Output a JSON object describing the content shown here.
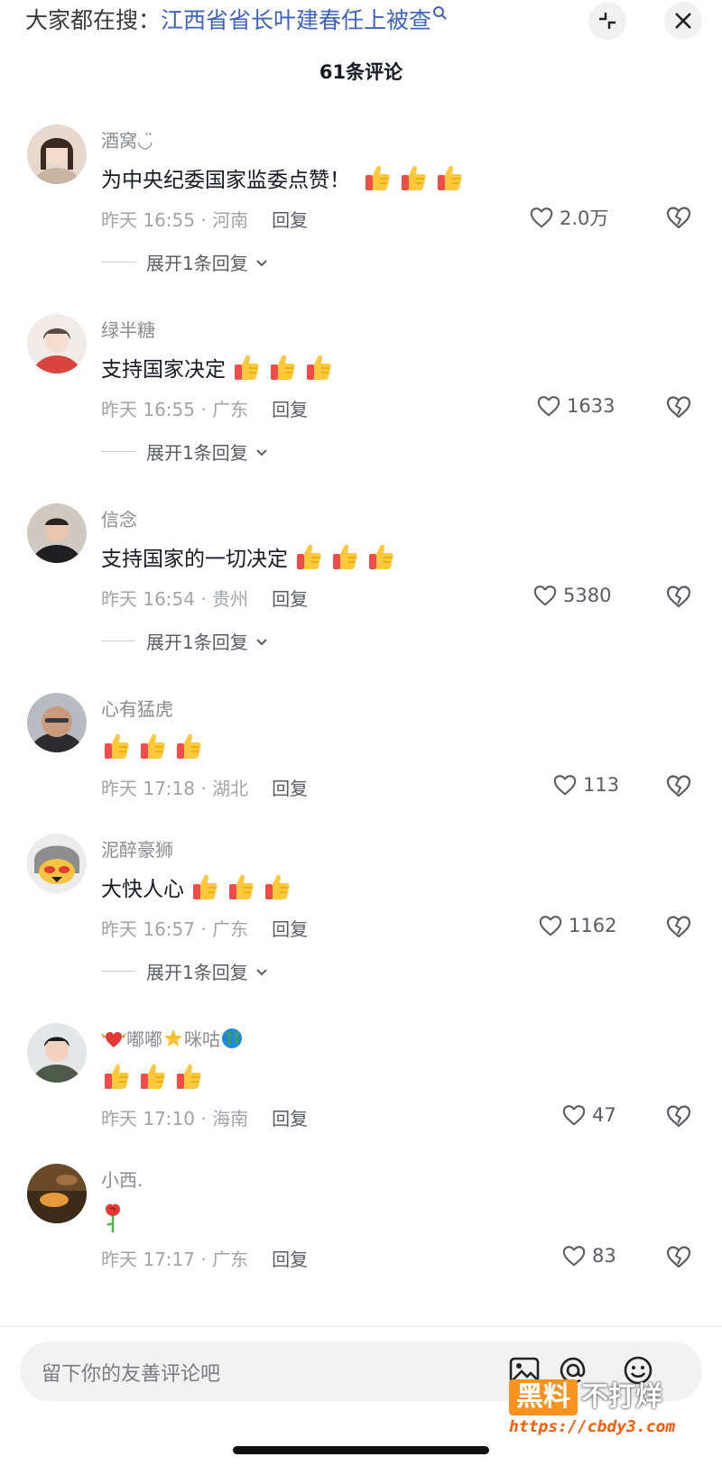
{
  "header": {
    "search_prefix": "大家都在搜：",
    "search_topic": "江西省省长叶建春任上被查",
    "comment_count": "61条评论"
  },
  "comments": [
    {
      "user": "酒窝◡̈",
      "text": "为中央纪委国家监委点赞！",
      "thumbs": 3,
      "time_location": "昨天 16:55 · 河南",
      "reply": "回复",
      "likes": "2.0万",
      "expand": "展开1条回复"
    },
    {
      "user": "绿半糖",
      "text": "支持国家决定",
      "thumbs": 3,
      "time_location": "昨天 16:55 · 广东",
      "reply": "回复",
      "likes": "1633",
      "expand": "展开1条回复"
    },
    {
      "user": "信念",
      "text": "支持国家的一切决定",
      "thumbs": 3,
      "time_location": "昨天 16:54 · 贵州",
      "reply": "回复",
      "likes": "5380",
      "expand": "展开1条回复"
    },
    {
      "user": "心有猛虎",
      "text": "",
      "thumbs": 3,
      "time_location": "昨天 17:18 · 湖北",
      "reply": "回复",
      "likes": "113",
      "expand": ""
    },
    {
      "user": "泥醉豪狮",
      "text": "大快人心",
      "thumbs": 3,
      "time_location": "昨天 16:57 · 广东",
      "reply": "回复",
      "likes": "1162",
      "expand": "展开1条回复"
    },
    {
      "user_parts": [
        "嘟嘟",
        "咪咕"
      ],
      "text": "",
      "thumbs": 3,
      "time_location": "昨天 17:10 · 海南",
      "reply": "回复",
      "likes": "47",
      "expand": ""
    },
    {
      "user": "小西.",
      "text": "",
      "thumbs": 0,
      "emoji": "rose",
      "time_location": "昨天 17:17 · 广东",
      "reply": "回复",
      "likes": "83",
      "expand": ""
    }
  ],
  "input": {
    "placeholder": "留下你的友善评论吧"
  },
  "icons": [
    "collapse-icon",
    "close-icon",
    "heart-icon",
    "dislike-heart-icon",
    "thumbs-up-icon",
    "chevron-down-icon",
    "image-icon",
    "at-icon",
    "emoji-icon",
    "rose-icon",
    "globe-icon",
    "star-icon",
    "heart-wing-icon"
  ],
  "watermark": {
    "badge": "黑料",
    "text": "不打烊",
    "url": "https://cbdy3.com"
  },
  "colors": {
    "topic_link": "#3f63b8",
    "secondary_text": "#8a8b91",
    "thumb_yellow": "#ffc83d",
    "thumb_red": "#f24b4b"
  }
}
